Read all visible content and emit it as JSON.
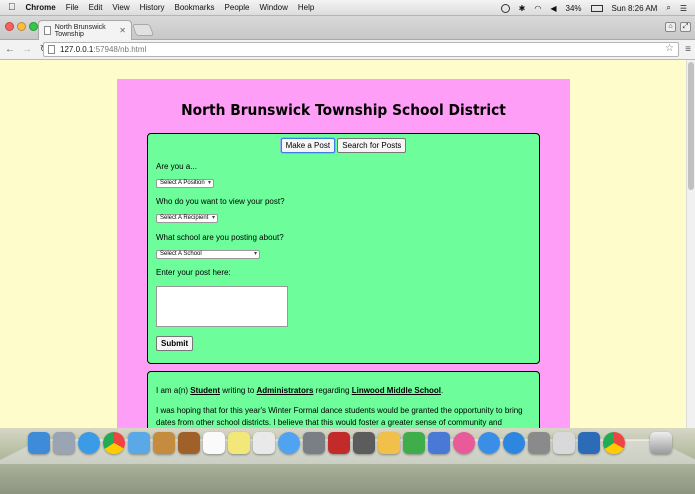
{
  "menubar": {
    "app": "Chrome",
    "items": [
      "File",
      "Edit",
      "View",
      "History",
      "Bookmarks",
      "People",
      "Window",
      "Help"
    ],
    "battery": "34%",
    "clock": "Sun 8:26 AM"
  },
  "browser": {
    "tab_title": "North Brunswick Township",
    "url_host": "127.0.0.1",
    "url_path": ":57948/nb.html"
  },
  "page": {
    "title": "North Brunswick Township School District",
    "tabs": [
      "Make a Post",
      "Search for Posts"
    ],
    "form": {
      "q1": "Are you a...",
      "q1_select": "Select A Position",
      "q2": "Who do you want to view your post?",
      "q2_select": "Select A Recipient",
      "q3": "What school are you posting about?",
      "q3_select": "Select A School",
      "q4": "Enter your post here:",
      "submit": "Submit"
    },
    "post": {
      "prefix": "I am a(n)",
      "role": "Student",
      "mid": "writing to",
      "recipient": "Administrators",
      "mid2": "regarding",
      "school": "Linwood Middle School",
      "end": ".",
      "body": "I was hoping that for this year's Winter Formal dance students would be granted the opportunity to bring dates from other school districts. I believe that this would foster a greater sense of community and collaborative spirit across different school"
    }
  },
  "colors": {
    "page_bg": "#fffccc",
    "container_bg": "#ff9ef6",
    "panel_bg": "#6dfe9b"
  }
}
